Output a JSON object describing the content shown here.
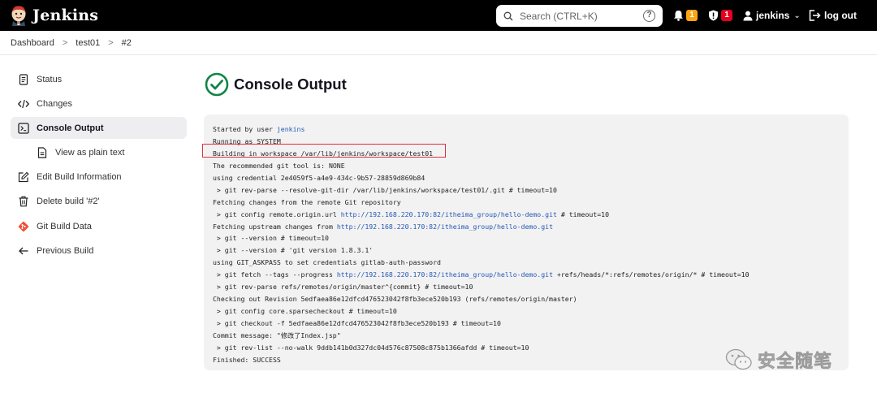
{
  "header": {
    "brand": "Jenkins",
    "search_placeholder": "Search (CTRL+K)",
    "help": "?",
    "notifications_count": "1",
    "security_count": "1",
    "user": "jenkins",
    "logout": "log out"
  },
  "breadcrumb": [
    "Dashboard",
    "test01",
    "#2"
  ],
  "sidebar": {
    "items": [
      {
        "label": "Status",
        "icon": "document-icon"
      },
      {
        "label": "Changes",
        "icon": "code-icon"
      },
      {
        "label": "Console Output",
        "icon": "terminal-icon",
        "active": true
      },
      {
        "label": "View as plain text",
        "icon": "document-icon",
        "sub": true
      },
      {
        "label": "Edit Build Information",
        "icon": "edit-icon"
      },
      {
        "label": "Delete build '#2'",
        "icon": "trash-icon"
      },
      {
        "label": "Git Build Data",
        "icon": "git-icon"
      },
      {
        "label": "Previous Build",
        "icon": "arrow-left-icon"
      }
    ]
  },
  "main": {
    "title": "Console Output"
  },
  "console": {
    "lines": [
      {
        "text": "Started by user ",
        "link": "jenkins",
        "after": ""
      },
      {
        "text": "Running as SYSTEM",
        "link": "",
        "after": ""
      },
      {
        "text": "Building in workspace /var/lib/jenkins/workspace/test01",
        "link": "",
        "after": ""
      },
      {
        "text": "The recommended git tool is: NONE",
        "link": "",
        "after": ""
      },
      {
        "text": "using credential 2e4059f5-a4e9-434c-9b57-28859d869b84",
        "link": "",
        "after": ""
      },
      {
        "text": " > git rev-parse --resolve-git-dir /var/lib/jenkins/workspace/test01/.git # timeout=10",
        "link": "",
        "after": ""
      },
      {
        "text": "Fetching changes from the remote Git repository",
        "link": "",
        "after": ""
      },
      {
        "text": " > git config remote.origin.url ",
        "link": "http://192.168.220.170:82/itheima_group/hello-demo.git",
        "after": " # timeout=10"
      },
      {
        "text": "Fetching upstream changes from ",
        "link": "http://192.168.220.170:82/itheima_group/hello-demo.git",
        "after": ""
      },
      {
        "text": " > git --version # timeout=10",
        "link": "",
        "after": ""
      },
      {
        "text": " > git --version # 'git version 1.8.3.1'",
        "link": "",
        "after": ""
      },
      {
        "text": "using GIT_ASKPASS to set credentials gitlab-auth-password",
        "link": "",
        "after": ""
      },
      {
        "text": " > git fetch --tags --progress ",
        "link": "http://192.168.220.170:82/itheima_group/hello-demo.git",
        "after": " +refs/heads/*:refs/remotes/origin/* # timeout=10"
      },
      {
        "text": " > git rev-parse refs/remotes/origin/master^{commit} # timeout=10",
        "link": "",
        "after": ""
      },
      {
        "text": "Checking out Revision 5edfaea86e12dfcd476523042f8fb3ece520b193 (refs/remotes/origin/master)",
        "link": "",
        "after": ""
      },
      {
        "text": " > git config core.sparsecheckout # timeout=10",
        "link": "",
        "after": ""
      },
      {
        "text": " > git checkout -f 5edfaea86e12dfcd476523042f8fb3ece520b193 # timeout=10",
        "link": "",
        "after": ""
      },
      {
        "text": "Commit message: \"修改了Index.jsp\"",
        "link": "",
        "after": ""
      },
      {
        "text": " > git rev-list --no-walk 9ddb141b0d327dc04d576c87508c875b1366afdd # timeout=10",
        "link": "",
        "after": ""
      },
      {
        "text": "Finished: SUCCESS",
        "link": "",
        "after": ""
      }
    ]
  },
  "watermark": "安全随笔",
  "colors": {
    "header_bg": "#000000",
    "badge_orange": "#fea514",
    "badge_red": "#e6001f",
    "success_green": "#138347",
    "link_blue": "#2458b3",
    "highlight_red": "#e0303a",
    "console_bg": "#f2f2f3"
  }
}
